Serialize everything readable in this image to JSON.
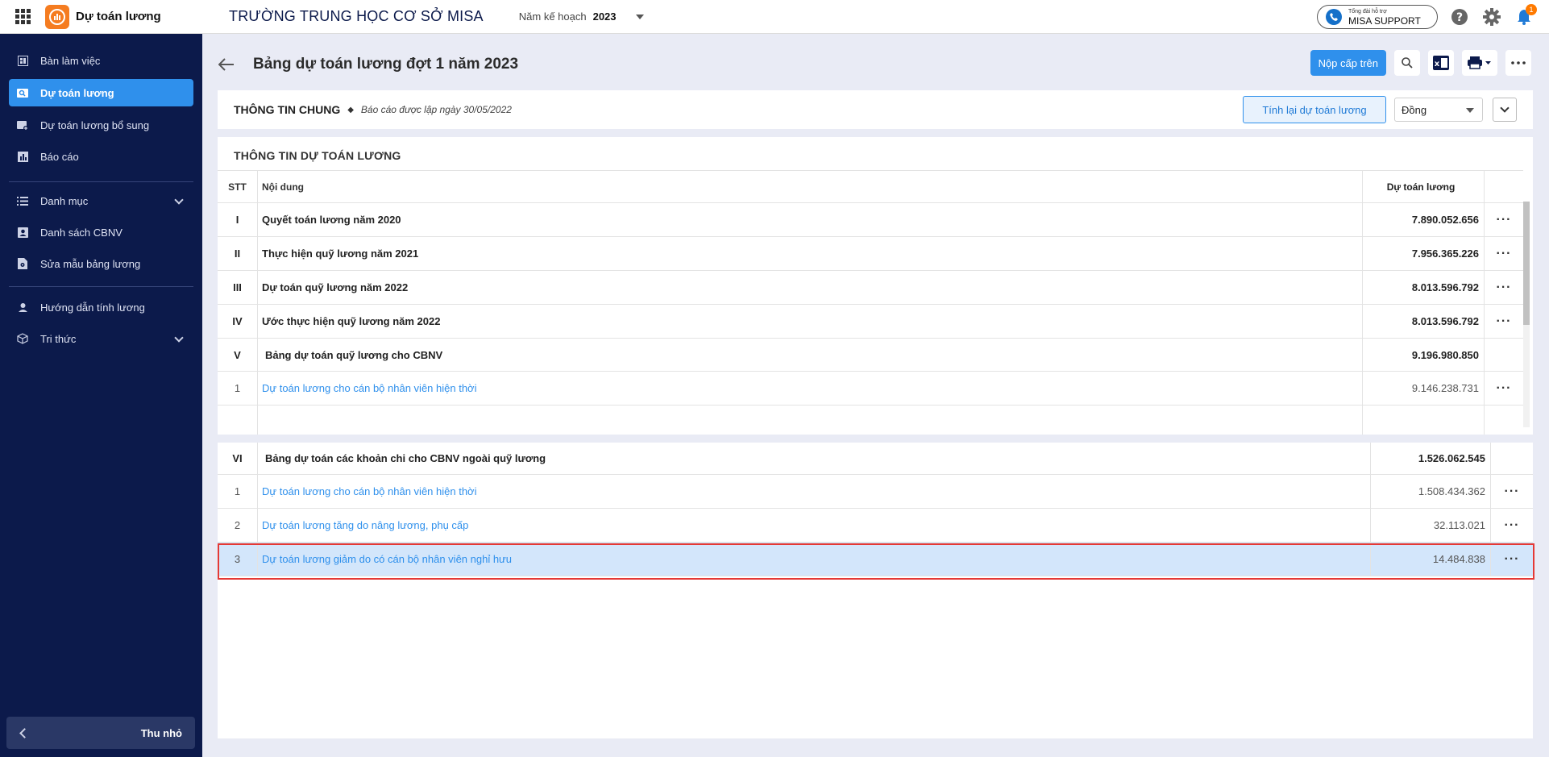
{
  "header": {
    "app_name": "Dự toán lương",
    "school_name": "TRƯỜNG TRUNG HỌC CƠ SỞ MISA",
    "year_label": "Năm kế hoạch",
    "year_value": "2023",
    "support_small": "Tổng đài hỗ trợ",
    "support_label": "MISA SUPPORT",
    "notification_count": "1"
  },
  "sidebar": {
    "items": [
      {
        "label": "Bàn làm việc",
        "icon": "dashboard-icon"
      },
      {
        "label": "Dự toán lương",
        "icon": "search-doc-icon",
        "active": true
      },
      {
        "label": "Dự toán lương bổ sung",
        "icon": "add-doc-icon"
      },
      {
        "label": "Báo cáo",
        "icon": "chart-icon"
      },
      {
        "label": "Danh mục",
        "icon": "list-icon"
      },
      {
        "label": "Danh sách CBNV",
        "icon": "contact-icon"
      },
      {
        "label": "Sửa mẫu bảng lương",
        "icon": "settings-doc-icon"
      },
      {
        "label": "Hướng dẫn tính lương",
        "icon": "guide-icon"
      },
      {
        "label": "Tri thức",
        "icon": "cube-icon"
      }
    ],
    "collapse_label": "Thu nhỏ"
  },
  "page": {
    "title": "Bảng dự toán lương đợt 1 năm 2023",
    "submit_label": "Nộp cấp trên"
  },
  "info": {
    "title": "THÔNG TIN CHUNG",
    "subtitle": "Báo cáo được lập ngày 30/05/2022",
    "recalc_label": "Tính lại dự toán lương",
    "unit": "Đồng"
  },
  "budget": {
    "section_title": "THÔNG TIN DỰ TOÁN LƯƠNG",
    "col_stt": "STT",
    "col_content": "Nội dung",
    "col_amount": "Dự toán lương",
    "rows": [
      {
        "stt": "I",
        "content": "Quyết toán lương năm 2020",
        "amount": "7.890.052.656"
      },
      {
        "stt": "II",
        "content": "Thực hiện quỹ lương năm 2021",
        "amount": "7.956.365.226"
      },
      {
        "stt": "III",
        "content": "Dự toán quỹ lương năm 2022",
        "amount": "8.013.596.792"
      },
      {
        "stt": "IV",
        "content": "Ước thực hiện quỹ lương năm 2022",
        "amount": "8.013.596.792"
      },
      {
        "stt": "V",
        "content": "Bảng dự toán quỹ lương cho CBNV",
        "amount": "9.196.980.850"
      },
      {
        "stt": "1",
        "content": "Dự toán lương cho cán bộ nhân viên hiện thời",
        "amount": "9.146.238.731"
      }
    ]
  },
  "other": {
    "rows": [
      {
        "stt": "VI",
        "content": "Bảng dự toán các khoản chi cho CBNV ngoài quỹ lương",
        "amount": "1.526.062.545"
      },
      {
        "stt": "1",
        "content": "Dự toán lương cho cán bộ nhân viên hiện thời",
        "amount": "1.508.434.362"
      },
      {
        "stt": "2",
        "content": "Dự toán lương tăng do nâng lương, phụ cấp",
        "amount": "32.113.021"
      },
      {
        "stt": "3",
        "content": "Dự toán lương giảm do có cán bộ nhân viên nghỉ hưu",
        "amount": "14.484.838"
      }
    ]
  },
  "more_symbol": "···"
}
